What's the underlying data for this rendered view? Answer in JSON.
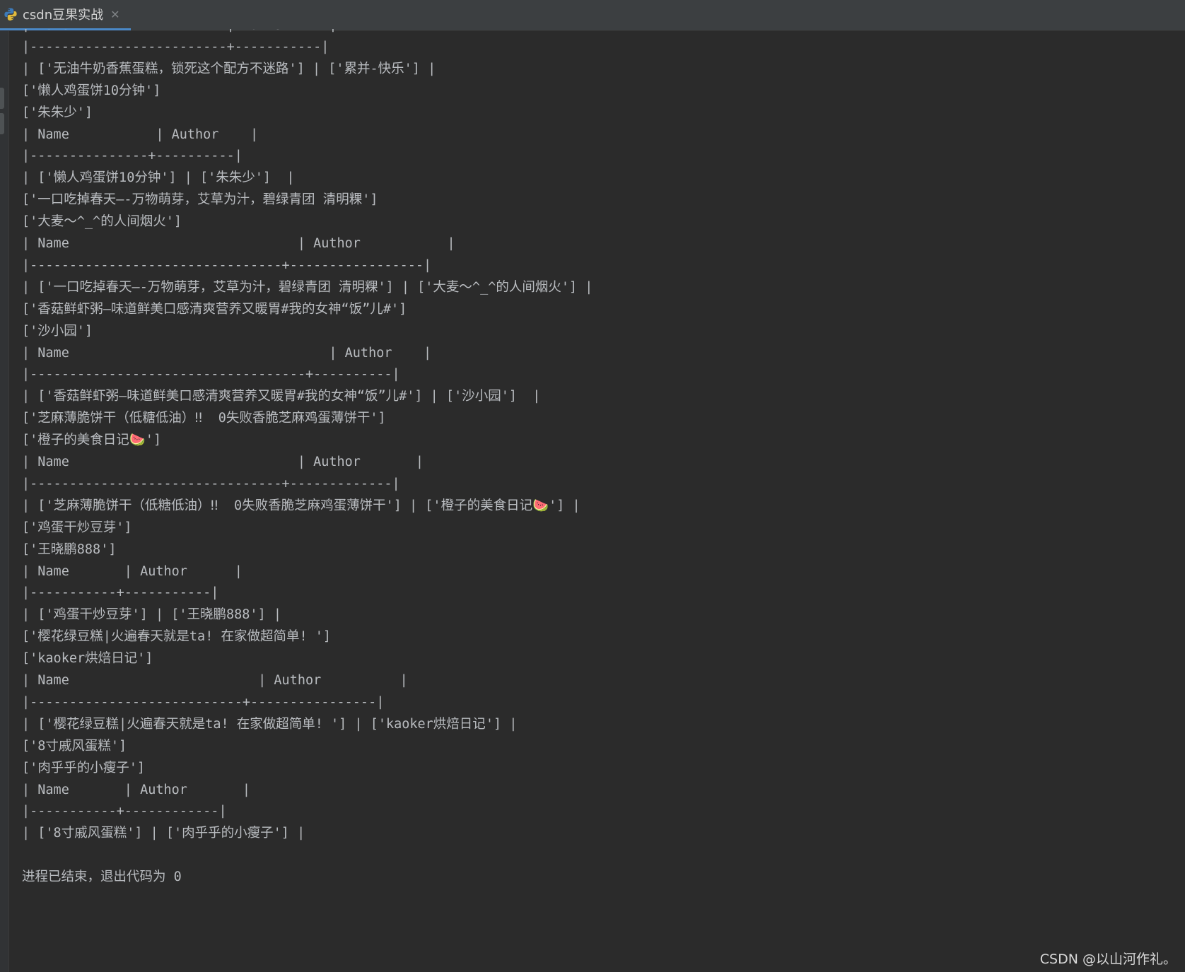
{
  "tab": {
    "label": "csdn豆果实战",
    "icon": "python-icon",
    "close_glyph": "✕"
  },
  "console": {
    "lines": [
      "| Name                    | Author     |",
      "|-------------------------+-----------|",
      "| ['无油牛奶香蕉蛋糕，锁死这个配方不迷路'] | ['累并-快乐'] |",
      "['懒人鸡蛋饼10分钟']",
      "['朱朱少']",
      "| Name           | Author    |",
      "|---------------+----------|",
      "| ['懒人鸡蛋饼10分钟'] | ['朱朱少']  |",
      "['一口吃掉春天—-万物萌芽，艾草为汁，碧绿青团 清明粿']",
      "['大麦～^_^的人间烟火']",
      "| Name                             | Author           |",
      "|--------------------------------+-----------------|",
      "| ['一口吃掉春天—-万物萌芽，艾草为汁，碧绿青团 清明粿'] | ['大麦～^_^的人间烟火'] |",
      "['香菇鲜虾粥—味道鲜美口感清爽营养又暖胃#我的女神“饭”儿#']",
      "['沙小园']",
      "| Name                                 | Author    |",
      "|-----------------------------------+----------|",
      "| ['香菇鲜虾粥—味道鲜美口感清爽营养又暖胃#我的女神“饭”儿#'] | ['沙小园']  |",
      "['芝麻薄脆饼干（低糖低油）‼  0失败香脆芝麻鸡蛋薄饼干']",
      "['橙子的美食日记🍉']",
      "| Name                             | Author       |",
      "|--------------------------------+-------------|",
      "| ['芝麻薄脆饼干（低糖低油）‼  0失败香脆芝麻鸡蛋薄饼干'] | ['橙子的美食日记🍉'] |",
      "['鸡蛋干炒豆芽']",
      "['王晓鹏888']",
      "| Name       | Author      |",
      "|-----------+-----------|",
      "| ['鸡蛋干炒豆芽'] | ['王晓鹏888'] |",
      "['樱花绿豆糕|火遍春天就是ta! 在家做超简单! ']",
      "['kaoker烘焙日记']",
      "| Name                        | Author          |",
      "|---------------------------+----------------|",
      "| ['樱花绿豆糕|火遍春天就是ta! 在家做超简单! '] | ['kaoker烘焙日记'] |",
      "['8寸戚风蛋糕']",
      "['肉乎乎的小瘦子']",
      "| Name       | Author       |",
      "|-----------+------------|",
      "| ['8寸戚风蛋糕'] | ['肉乎乎的小瘦子'] |",
      "",
      "进程已结束，退出代码为 0"
    ]
  },
  "watermark": "CSDN @以山河作礼。",
  "colors": {
    "background": "#2b2b2b",
    "text": "#b9bcc0",
    "tab_underline": "#4a88c7"
  }
}
